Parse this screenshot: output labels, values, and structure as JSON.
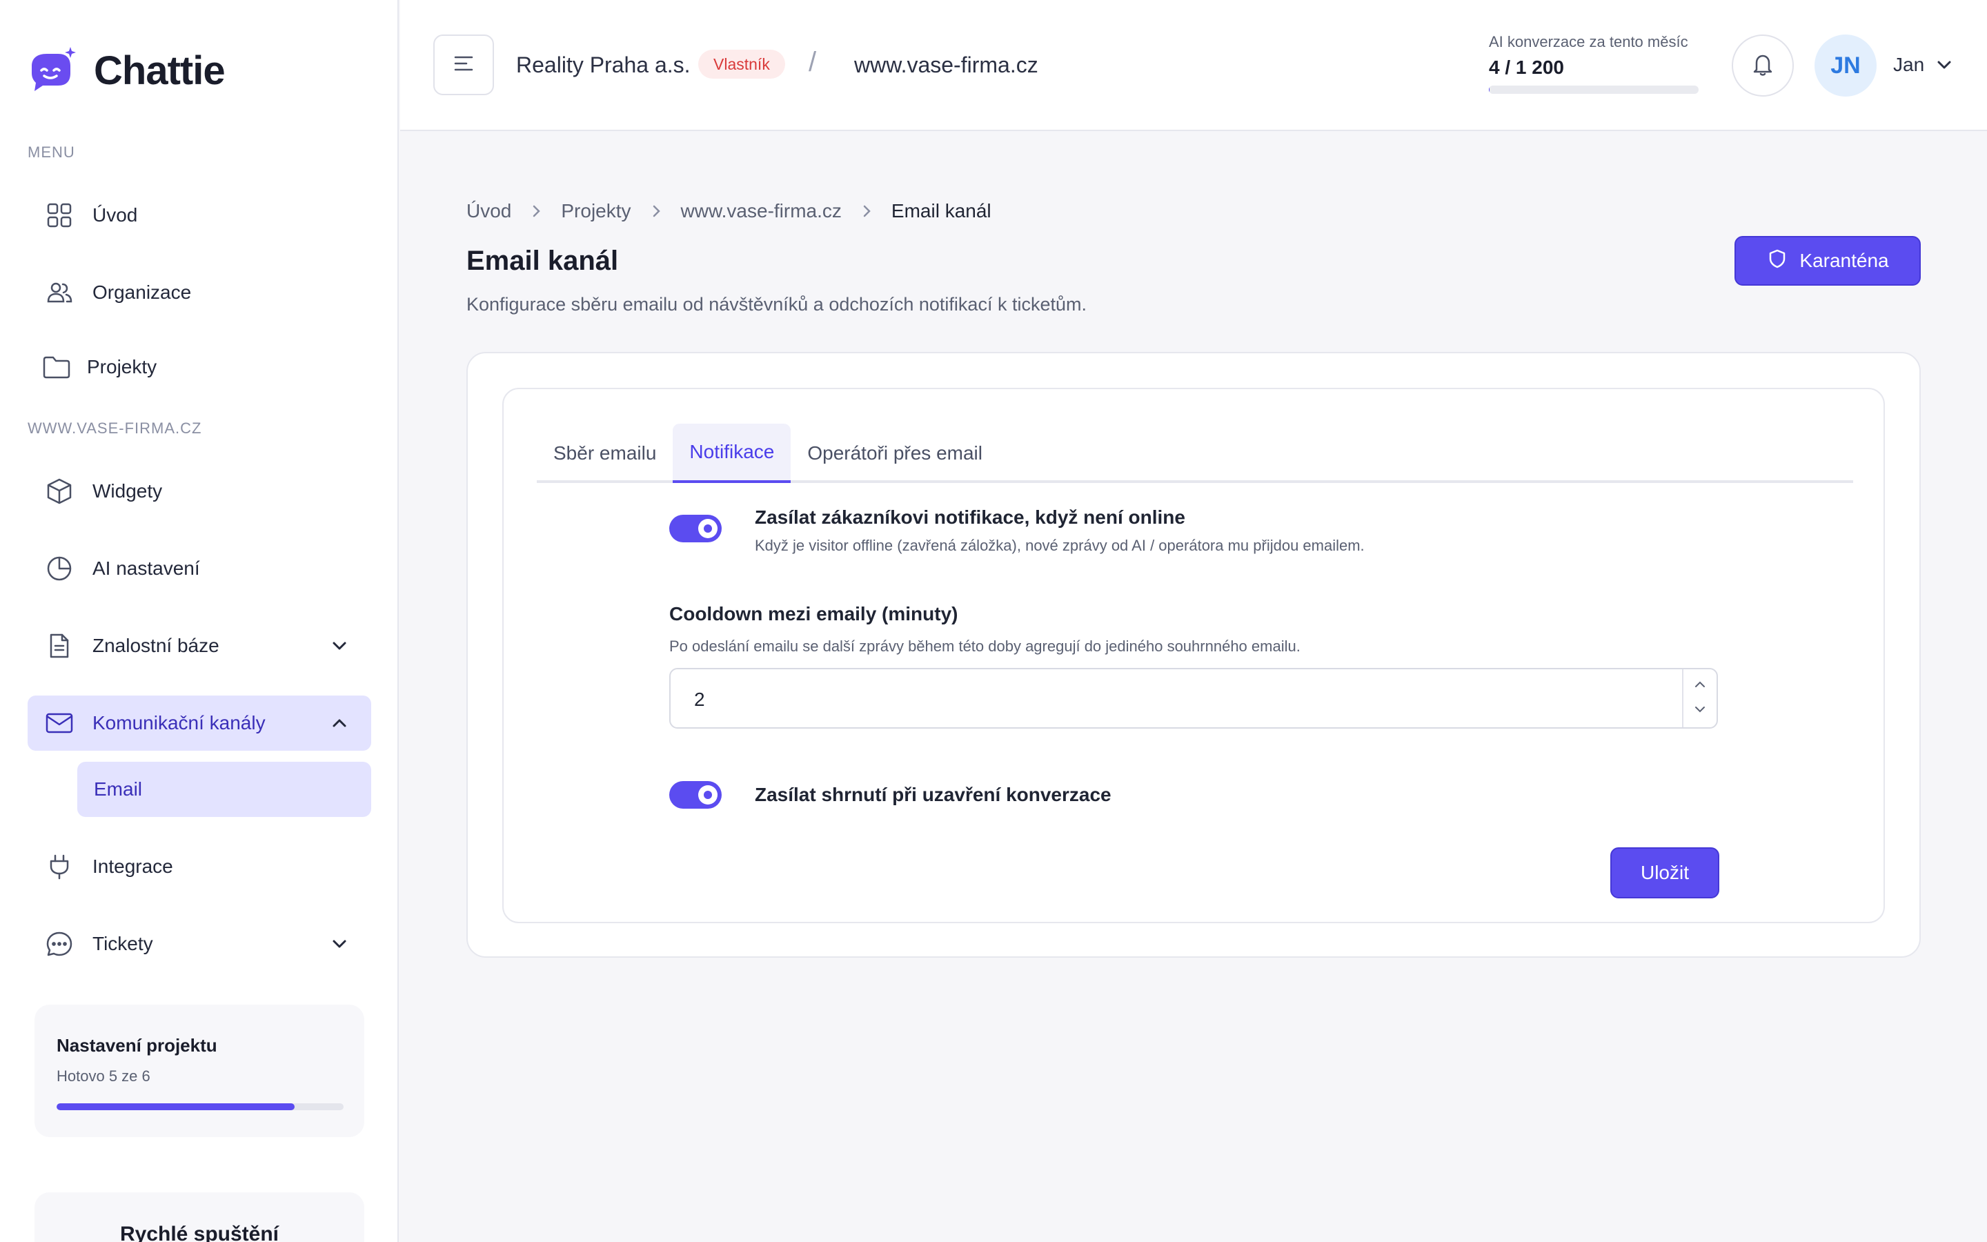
{
  "app": {
    "name": "Chattie"
  },
  "sidebar": {
    "menu_label": "MENU",
    "main_items": [
      {
        "label": "Úvod",
        "icon": "grid-icon"
      },
      {
        "label": "Organizace",
        "icon": "users-icon"
      },
      {
        "label": "Projekty",
        "icon": "folder-icon"
      }
    ],
    "project_label": "WWW.VASE-FIRMA.CZ",
    "project_items": [
      {
        "label": "Widgety",
        "icon": "cube-icon"
      },
      {
        "label": "AI nastavení",
        "icon": "pie-chart-icon"
      },
      {
        "label": "Znalostní báze",
        "icon": "document-icon",
        "expandable": true
      },
      {
        "label": "Komunikační kanály",
        "icon": "mail-icon",
        "expanded": true,
        "active": true
      },
      {
        "label": "Integrace",
        "icon": "plug-icon"
      },
      {
        "label": "Tickety",
        "icon": "chat-icon",
        "expandable": true
      }
    ],
    "sub_item": {
      "label": "Email"
    },
    "setup": {
      "title": "Nastavení projektu",
      "progress_text": "Hotovo 5 ze 6",
      "progress": 0.83
    },
    "quick_start": {
      "title": "Rychlé spuštění"
    }
  },
  "header": {
    "org_name": "Reality Praha a.s.",
    "role_badge": "Vlastník",
    "separator": "/",
    "site": "www.vase-firma.cz",
    "usage": {
      "label": "AI konverzace za tento měsíc",
      "value": "4 / 1 200",
      "fraction": 0.003
    },
    "avatar_initials": "JN",
    "user_name": "Jan"
  },
  "breadcrumb": [
    "Úvod",
    "Projekty",
    "www.vase-firma.cz",
    "Email kanál"
  ],
  "page": {
    "title": "Email kanál",
    "description": "Konfigurace sběru emailu od návštěvníků a odchozích notifikací k ticketům.",
    "quarantine_button": "Karanténa"
  },
  "tabs": [
    {
      "label": "Sběr emailu",
      "active": false
    },
    {
      "label": "Notifikace",
      "active": true
    },
    {
      "label": "Operátoři přes email",
      "active": false
    }
  ],
  "settings": {
    "notify_offline": {
      "title": "Zasílat zákazníkovi notifikace, když není online",
      "description": "Když je visitor offline (zavřená záložka), nové zprávy od AI / operátora mu přijdou emailem.",
      "enabled": true
    },
    "cooldown": {
      "label": "Cooldown mezi emaily (minuty)",
      "description": "Po odeslání emailu se další zprávy během této doby agregují do jediného souhrnného emailu.",
      "value": "2"
    },
    "summary_on_close": {
      "title": "Zasílat shrnutí při uzavření konverzace",
      "enabled": true
    },
    "save_button": "Uložit"
  },
  "colors": {
    "accent": "#5b4cf0",
    "active_bg": "#e3e3ff",
    "badge_bg": "#fdecec",
    "badge_text": "#d93a3a",
    "avatar_text": "#2d7ae0"
  }
}
